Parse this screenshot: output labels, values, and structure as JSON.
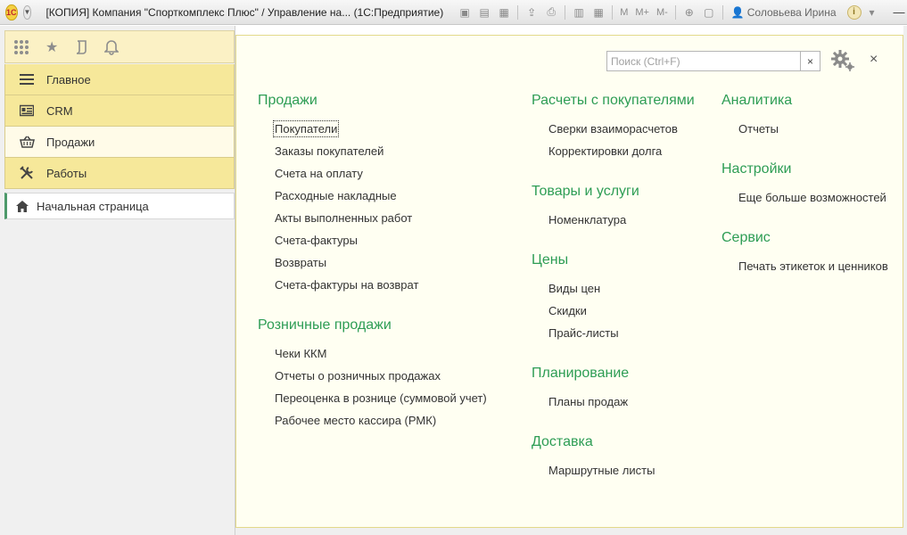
{
  "titlebar": {
    "logo_text": "1С",
    "title": "[КОПИЯ] Компания \"Спорткомплекс Плюс\" / Управление на... (1С:Предприятие)",
    "m_buttons": [
      "M",
      "M+",
      "M-"
    ],
    "user": "Соловьева Ирина",
    "info": "i",
    "minimize": "—",
    "maximize": "☐",
    "close": "✕"
  },
  "quickbar": {
    "icons": [
      "apps-grid-icon",
      "favorites-star-icon",
      "history-icon",
      "notifications-bell-icon"
    ]
  },
  "sections": [
    {
      "label": "Главное",
      "icon": "menu-lines-icon",
      "active": false
    },
    {
      "label": "CRM",
      "icon": "crm-card-icon",
      "active": false
    },
    {
      "label": "Продажи",
      "icon": "basket-icon",
      "active": true
    },
    {
      "label": "Работы",
      "icon": "tools-icon",
      "active": false
    }
  ],
  "home": {
    "label": "Начальная страница"
  },
  "search": {
    "placeholder": "Поиск (Ctrl+F)",
    "value": "",
    "clear": "×"
  },
  "close_panel": "×",
  "columns": {
    "col1": [
      {
        "title": "Продажи",
        "links": [
          "Покупатели",
          "Заказы покупателей",
          "Счета на оплату",
          "Расходные накладные",
          "Акты выполненных работ",
          "Счета-фактуры",
          "Возвраты",
          "Счета-фактуры на возврат"
        ]
      },
      {
        "title": "Розничные продажи",
        "links": [
          "Чеки ККМ",
          "Отчеты о розничных продажах",
          "Переоценка в рознице (суммовой учет)",
          "Рабочее место кассира (РМК)"
        ]
      }
    ],
    "col2": [
      {
        "title": "Расчеты с покупателями",
        "links": [
          "Сверки взаиморасчетов",
          "Корректировки долга"
        ]
      },
      {
        "title": "Товары и услуги",
        "links": [
          "Номенклатура"
        ]
      },
      {
        "title": "Цены",
        "links": [
          "Виды цен",
          "Скидки",
          "Прайс-листы"
        ]
      },
      {
        "title": "Планирование",
        "links": [
          "Планы продаж"
        ]
      },
      {
        "title": "Доставка",
        "links": [
          "Маршрутные листы"
        ]
      }
    ],
    "col3": [
      {
        "title": "Аналитика",
        "links": [
          "Отчеты"
        ]
      },
      {
        "title": "Настройки",
        "links": [
          "Еще больше возможностей"
        ]
      },
      {
        "title": "Сервис",
        "links": [
          "Печать этикеток и ценников"
        ]
      }
    ]
  },
  "colors": {
    "accent_green": "#2e9d55",
    "section_yellow": "#f6e89a",
    "content_bg": "#fffff2"
  }
}
